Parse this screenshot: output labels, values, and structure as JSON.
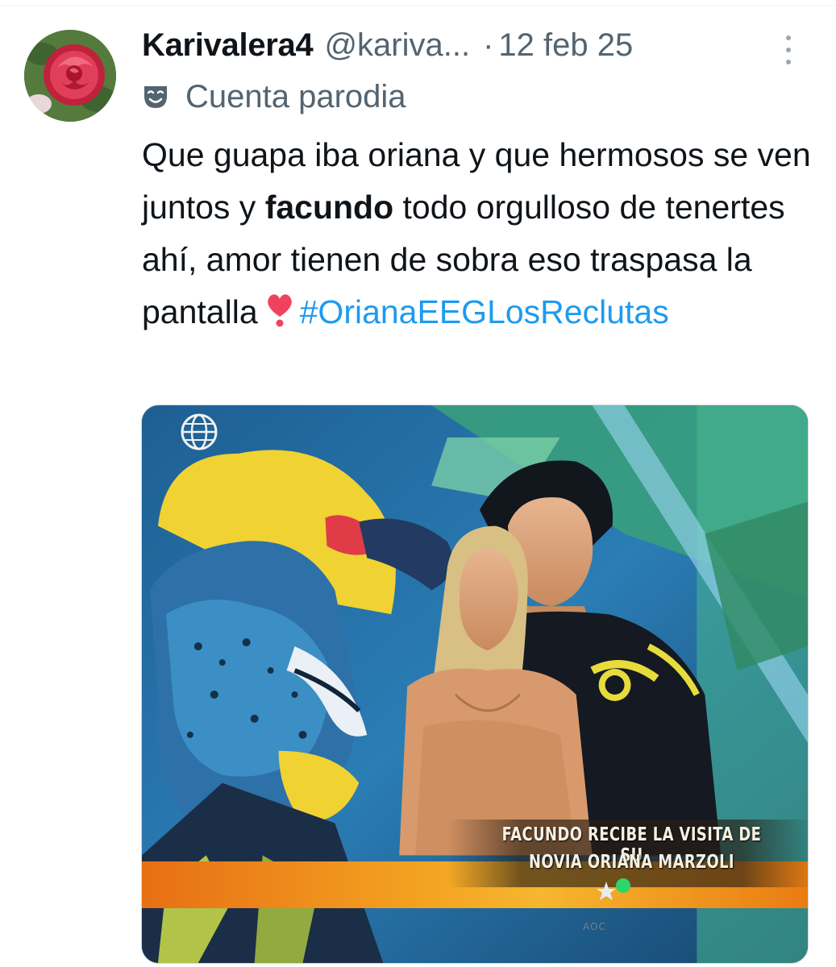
{
  "author": {
    "display_name": "Karivalera4",
    "handle": "@kariva...",
    "separator": "·",
    "date": "12 feb 25",
    "badge_label": "Cuenta parodia"
  },
  "tweet": {
    "text_1": "Que guapa iba oriana y que hermosos se ven juntos y ",
    "bold_word": "facundo",
    "text_2": " todo orgulloso de tenertes ahí, amor tienen de sobra eso traspasa la pantalla",
    "emoji": "heart-exclamation",
    "hashtag": "#OrianaEEGLosReclutas"
  },
  "media": {
    "caption_line_1": "FACUNDO RECIBE LA VISITA DE SU",
    "caption_line_2": "NOVIA ORIANA MARZOLI",
    "tv_brand": "AOC"
  },
  "icons": {
    "more": "more-vertical-icon",
    "parody": "theater-mask-icon",
    "channel": "globe-logo-icon"
  },
  "colors": {
    "text": "#0f1419",
    "secondary": "#536471",
    "link": "#1d9bf0",
    "caption_bar": "#f3a020"
  }
}
